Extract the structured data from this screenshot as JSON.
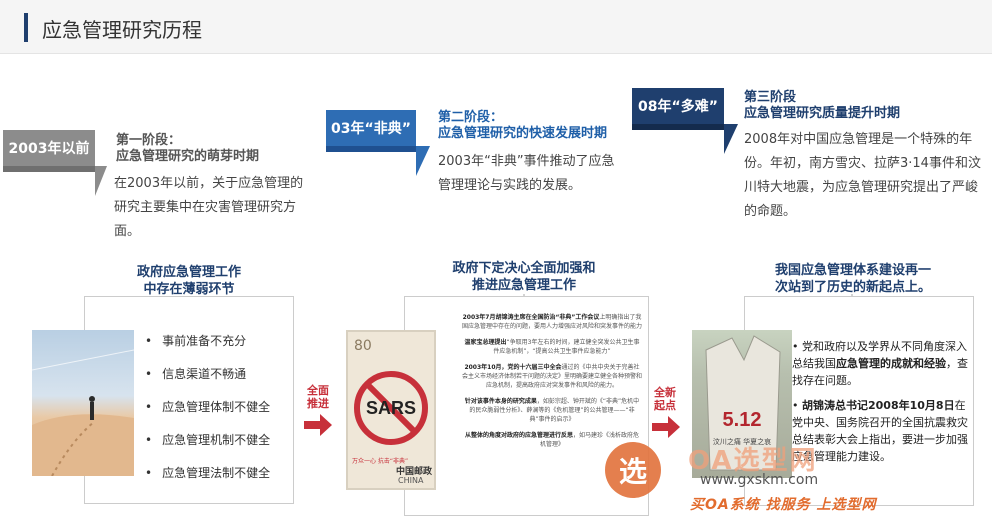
{
  "header": {
    "title": "应急管理研究历程"
  },
  "stages": [
    {
      "tag": "2003年以前",
      "title_line1": "第一阶段：",
      "title_line2": "应急管理研究的萌芽时期",
      "desc": "在2003年以前，关于应急管理的研究主要集中在灾害管理研究方面。"
    },
    {
      "tag": "03年“非典”",
      "title_line1": "第二阶段：",
      "title_line2": "应急管理研究的快速发展时期",
      "desc": "2003年“非典”事件推动了应急管理理论与实践的发展。"
    },
    {
      "tag": "08年“多难”",
      "title_line1": "第三阶段",
      "title_line2": "应急管理研究质量提升时期",
      "desc": "2008年对中国应急管理是一个特殊的年份。年初，南方雪灾、拉萨3·14事件和汶川特大地震，为应急管理研究提出了严峻的命题。"
    }
  ],
  "columns": [
    {
      "heading_line1": "政府应急管理工作",
      "heading_line2": "中存在薄弱环节",
      "items": [
        "事前准备不充分",
        "信息渠道不畅通",
        "应急管理体制不健全",
        "应急管理机制不健全",
        "应急管理法制不健全"
      ]
    },
    {
      "heading_line1": "政府下定决心全面加强和",
      "heading_line2": "推进应急管理工作",
      "items": [
        {
          "bold": "2003年7月胡锦涛主席在全国防治“非典”工作会议",
          "rest": "上明确指出了我国应急管理中存在的问题，要用人力增强应对风险和突发事件的能力"
        },
        {
          "bold": "温家宝总理提出",
          "rest": "“争取用3年左右的时间，建立健全突发公共卫生事件应急机制”，“提高公共卫生事件应急能力”"
        },
        {
          "bold": "2003年10月，党的十六届三中全会",
          "rest": "通过的《中共中央关于完善社会主义市场经济体制若干问题的决定》里明确要建立健全各种预警和应急机制，提高政府应对突发事件和风险的能力。"
        },
        {
          "bold": "针对该事件本身的研究成果",
          "rest": "，如彭宗超、钟开斌的《“非典”危机中的民众脆弱性分析》、薛澜等的《危机管理”的公共管理——“非典”事件的启示》"
        },
        {
          "bold": "从整体的角度对政府的应急管理进行反思",
          "rest": "，如马建珍《浅析政府危机管理》"
        }
      ],
      "stamp_value": "80",
      "stamp_label": "SARS",
      "stamp_slogan": "万众一心 抗击“非典”",
      "stamp_brand": "中国邮政",
      "stamp_country": "CHINA"
    },
    {
      "heading_line1": "我国应急管理体系建设再一",
      "heading_line2": "次站到了历史的新起点上。",
      "items": [
        {
          "bold": "",
          "pre": "党和政府以及学界从不同角度深入总结我国",
          "boldmid": "应急管理的成就和经验",
          "rest": "，查找存在问题。"
        },
        {
          "bold": "胡锦涛总书记2008年10月8日",
          "pre": "",
          "boldmid": "",
          "rest": "在党中央、国务院召开的全国抗震救灾总结表彰大会上指出，要进一步加强应急管理能力建设。"
        }
      ],
      "rock_text": "5.12",
      "rock_caption": "汶川之痛 华夏之哀"
    }
  ],
  "connectors": [
    {
      "line1": "全面",
      "line2": "推进"
    },
    {
      "line1": "全新",
      "line2": "起点"
    }
  ],
  "watermark": {
    "badge": "选",
    "brand": "OA选型网",
    "url": "www.gxskm.com",
    "slogan": "买OA系统 找服务 上选型网"
  },
  "colors": {
    "navy": "#1f3f6e",
    "blue": "#2e6db4",
    "gray": "#8c8c8c",
    "red": "#c7303a",
    "orange": "#e2753f"
  }
}
